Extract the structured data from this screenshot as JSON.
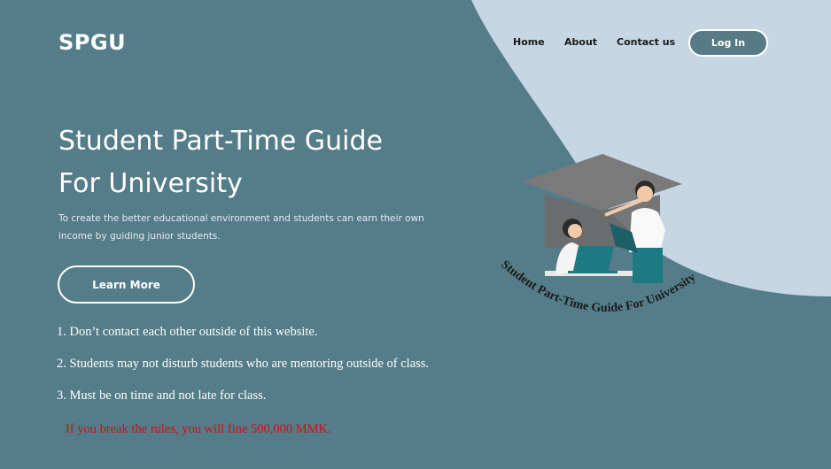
{
  "header": {
    "logo": "SPGU",
    "nav": {
      "home": "Home",
      "about": "About",
      "contact": "Contact us"
    },
    "login_label": "Log In"
  },
  "hero": {
    "title_line1": "Student Part-Time Guide",
    "title_line2": "For University",
    "description": "To create the better educational environment and students can earn their own income by guiding junior students.",
    "cta_label": "Learn More"
  },
  "illustration": {
    "arc_text": "Student Part-Time Guide  For  University"
  },
  "rules": [
    "1. Don’t contact each other outside of this website.",
    "2. Students may not disturb students who are mentoring outside of class.",
    "3. Must be on time and not late for class."
  ],
  "warning": "If you break the rules, you will fine 500,000 MMK.",
  "colors": {
    "background": "#557c89",
    "accent_blob": "#c6d6e4",
    "warning": "#cc1111",
    "teal": "#1e7a82"
  }
}
